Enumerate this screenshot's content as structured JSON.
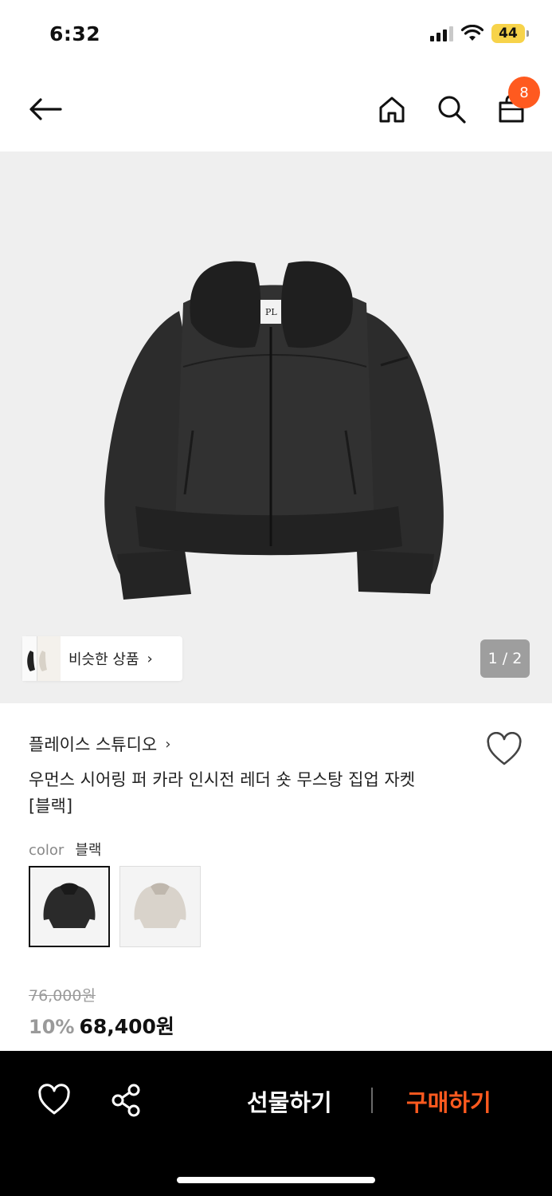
{
  "status": {
    "time": "6:32",
    "battery": "44"
  },
  "header": {
    "icons": [
      "back-arrow-icon",
      "home-icon",
      "search-icon",
      "shopping-bag-icon"
    ],
    "cart_count": "8",
    "badge_color": "#ff5a1f"
  },
  "gallery": {
    "similar_label": "비슷한 상품",
    "page_indicator": "1 / 2",
    "background": "#efefef"
  },
  "product": {
    "brand": "플레이스 스튜디오",
    "title_line1": "우먼스 시어링 퍼 카라 인시전 레더 숏 무스탕 집업 자켓",
    "title_line2": "[블랙]",
    "color_label": "color",
    "color_value": "블랙",
    "swatches": [
      {
        "name": "블랙",
        "selected": true
      },
      {
        "name": "아이보리",
        "selected": false
      }
    ],
    "original_price": "76,000원",
    "discount": "10%",
    "price": "68,400원"
  },
  "bottom_bar": {
    "gift_label": "선물하기",
    "buy_label": "구매하기",
    "accent_color": "#ff5a1f",
    "icons": [
      "heart-icon",
      "share-icon"
    ]
  }
}
